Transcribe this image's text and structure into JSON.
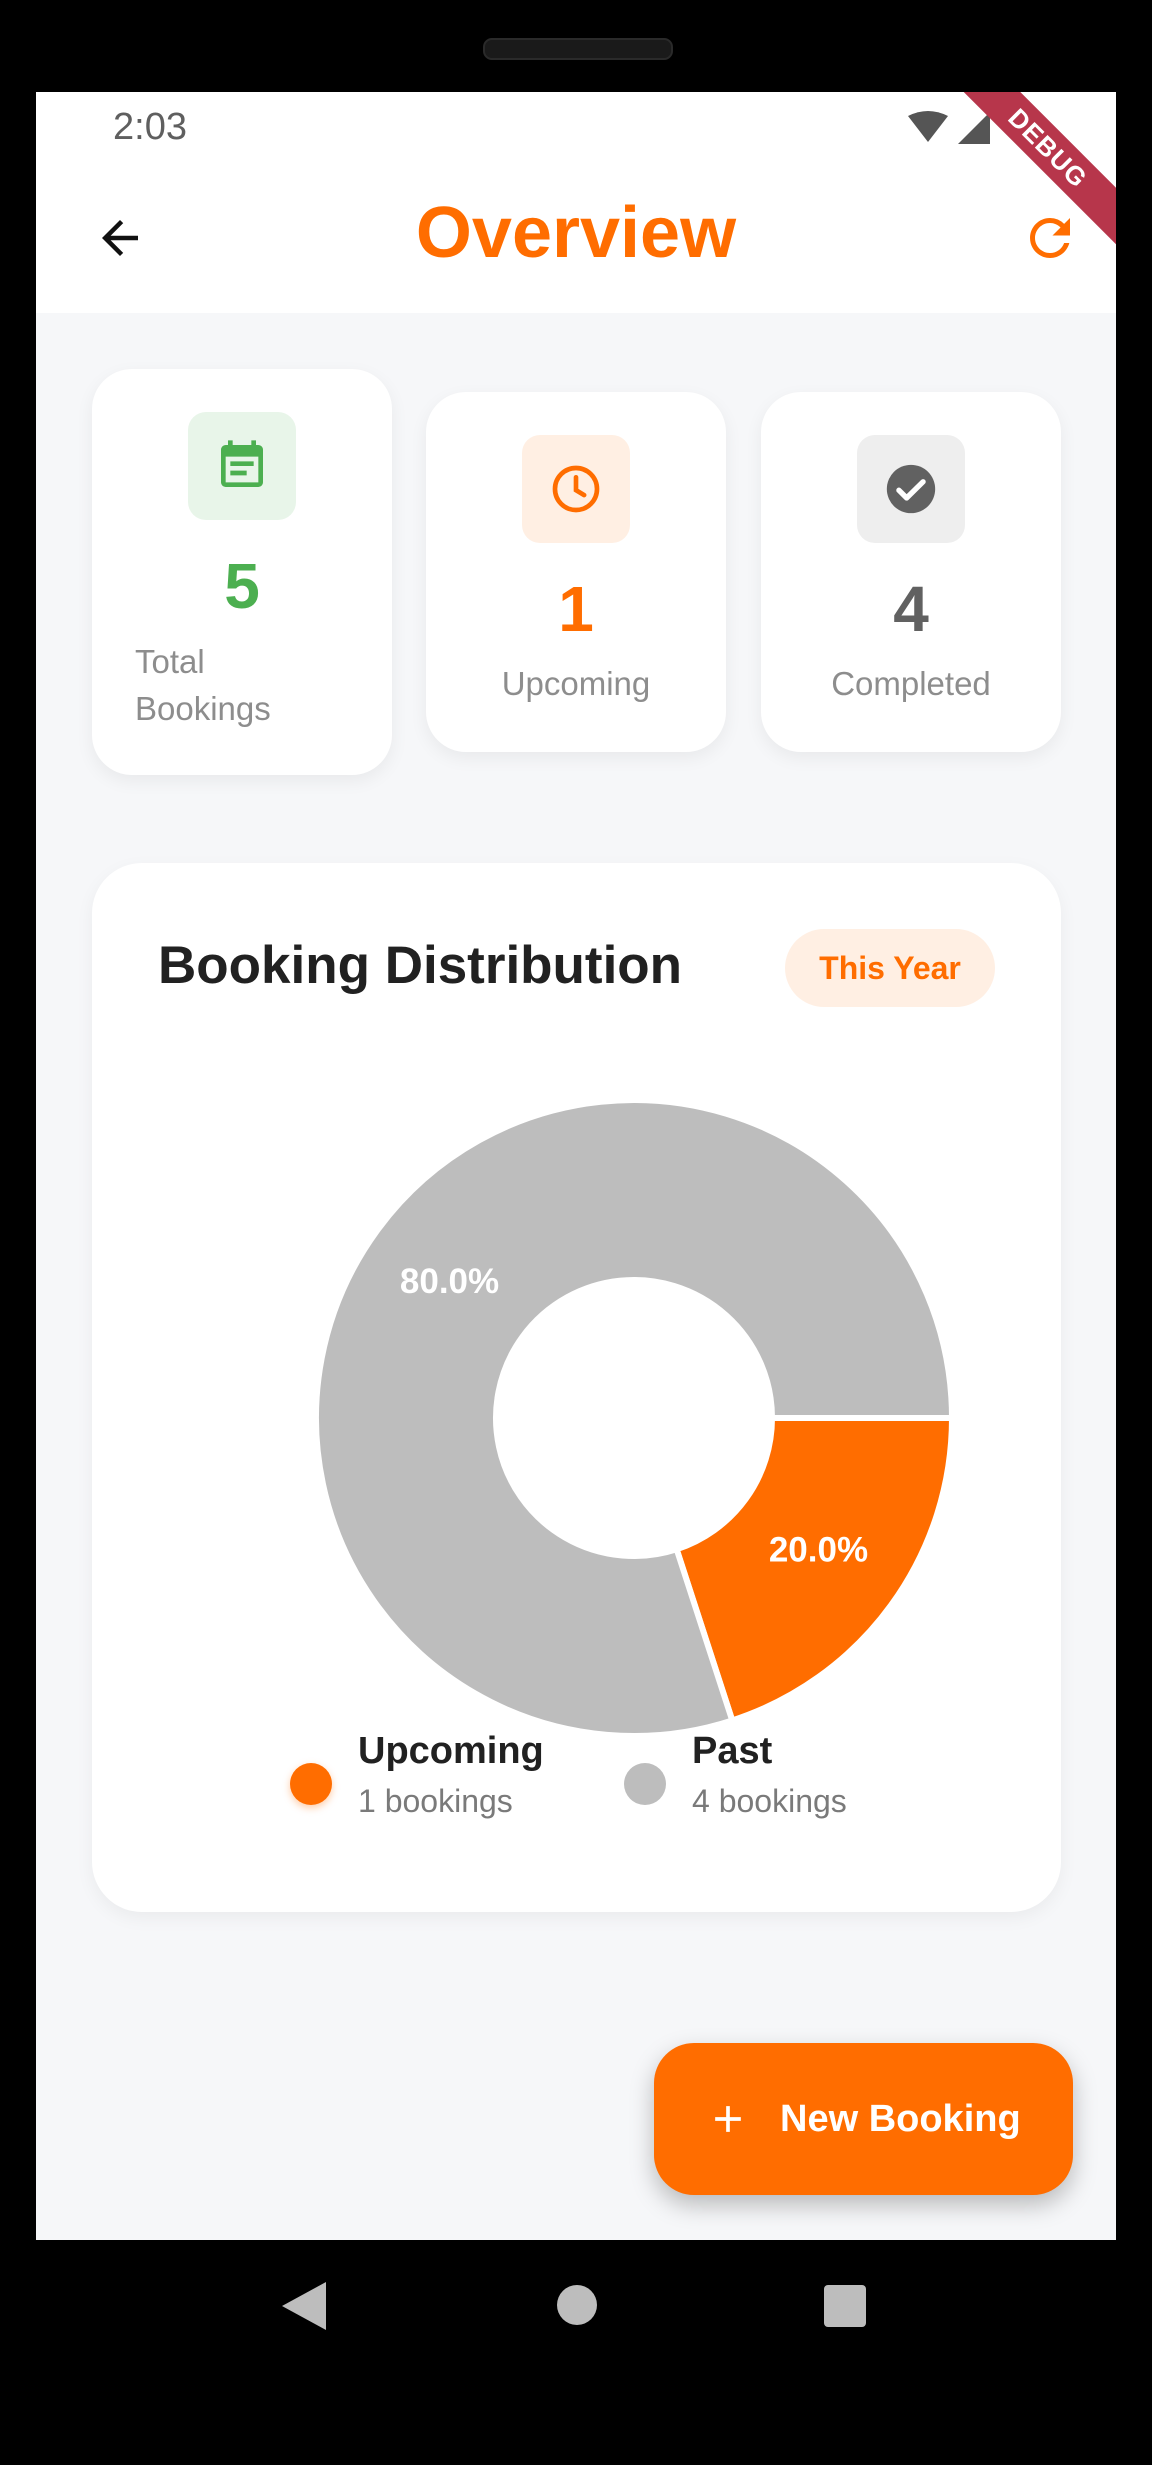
{
  "status_bar": {
    "time": "2:03",
    "debug_label": "DEBUG"
  },
  "app_bar": {
    "title": "Overview",
    "back_icon": "arrow-back-icon",
    "refresh_icon": "refresh-icon"
  },
  "stats": [
    {
      "value": "5",
      "label_line1": "Total",
      "label_line2": "Bookings",
      "icon": "calendar-icon",
      "color": "#4CAF50",
      "bg": "#E8F5E9"
    },
    {
      "value": "1",
      "label": "Upcoming",
      "icon": "clock-icon",
      "color": "#FF6D00",
      "bg": "#FFEFE3"
    },
    {
      "value": "4",
      "label": "Completed",
      "icon": "check-circle-icon",
      "color": "#616161",
      "bg": "#EEEEEE"
    }
  ],
  "distribution": {
    "title": "Booking Distribution",
    "period": "This Year",
    "legend": [
      {
        "name": "Upcoming",
        "sub": "1 bookings",
        "color": "#FF6D00"
      },
      {
        "name": "Past",
        "sub": "4 bookings",
        "color": "#BDBDBD"
      }
    ]
  },
  "chart_data": {
    "type": "pie",
    "categories": [
      "Upcoming",
      "Past"
    ],
    "values": [
      1,
      4
    ],
    "labels": [
      "20.0%",
      "80.0%"
    ],
    "colors": [
      "#FF6D00",
      "#BDBDBD"
    ]
  },
  "fab": {
    "label": "New Booking",
    "icon": "plus-icon"
  },
  "nav_bar": {
    "back": "nav-back-icon",
    "home": "nav-home-icon",
    "recents": "nav-recents-icon"
  }
}
